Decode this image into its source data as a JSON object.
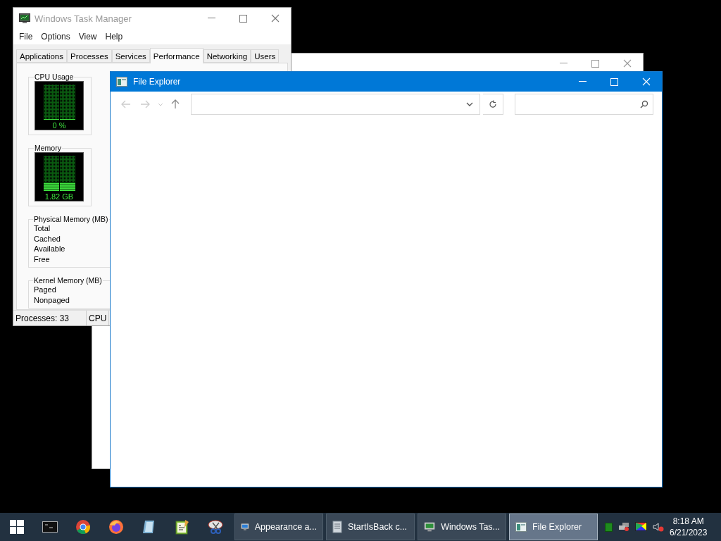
{
  "task_manager": {
    "title": "Windows Task Manager",
    "menu": [
      "File",
      "Options",
      "View",
      "Help"
    ],
    "tabs": [
      {
        "label": "Applications",
        "selected": false
      },
      {
        "label": "Processes",
        "selected": false
      },
      {
        "label": "Services",
        "selected": false
      },
      {
        "label": "Performance",
        "selected": true
      },
      {
        "label": "Networking",
        "selected": false
      },
      {
        "label": "Users",
        "selected": false
      }
    ],
    "groups": [
      {
        "kind": "meter",
        "title": "CPU Usage",
        "reading": "0 %",
        "level": 0
      },
      {
        "kind": "meter",
        "title": "Memory",
        "reading": "1.82 GB",
        "level": 0.22
      },
      {
        "kind": "list",
        "title": "Physical Memory (MB)",
        "rows": [
          "Total",
          "Cached",
          "Available",
          "Free"
        ]
      },
      {
        "kind": "list",
        "title": "Kernel Memory (MB)",
        "rows": [
          "Paged",
          "Nonpaged"
        ]
      }
    ],
    "status_bar": [
      "Processes: 33",
      "CPU"
    ]
  },
  "file_explorer": {
    "title": "File Explorer"
  },
  "taskbar": {
    "tasks": [
      {
        "label": "Appearance a...",
        "selected": false
      },
      {
        "label": "StartIsBack c...",
        "selected": false
      },
      {
        "label": "Windows Tas...",
        "selected": false
      },
      {
        "label": "File Explorer",
        "selected": true
      }
    ],
    "clock": {
      "time": "8:18 AM",
      "date": "6/21/2023"
    }
  }
}
